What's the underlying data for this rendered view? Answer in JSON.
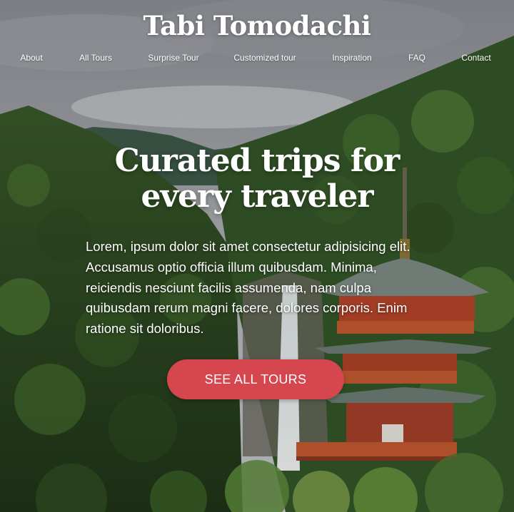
{
  "site": {
    "brand": "Tabi Tomodachi"
  },
  "nav": {
    "items": [
      {
        "label": "About"
      },
      {
        "label": "All Tours"
      },
      {
        "label": "Surprise Tour"
      },
      {
        "label": "Customized tour"
      },
      {
        "label": "Inspiration"
      },
      {
        "label": "FAQ"
      },
      {
        "label": "Contact"
      }
    ]
  },
  "hero": {
    "headline_line1": "Curated trips for",
    "headline_line2": "every traveler",
    "body": "Lorem, ipsum dolor sit amet consectetur adipisicing elit. Accusamus optio officia illum quibusdam. Minima, reiciendis nesciunt facilis assumenda, nam culpa quibusdam rerum magni facere, dolores corporis. Enim ratione sit doloribus.",
    "cta_label": "SEE ALL TOURS",
    "background_image": "forested-mountains-pagoda-waterfall"
  },
  "colors": {
    "cta": "#d6464f",
    "text": "#ffffff",
    "pagoda": "#c0522e",
    "forest": "#2f4d22"
  }
}
